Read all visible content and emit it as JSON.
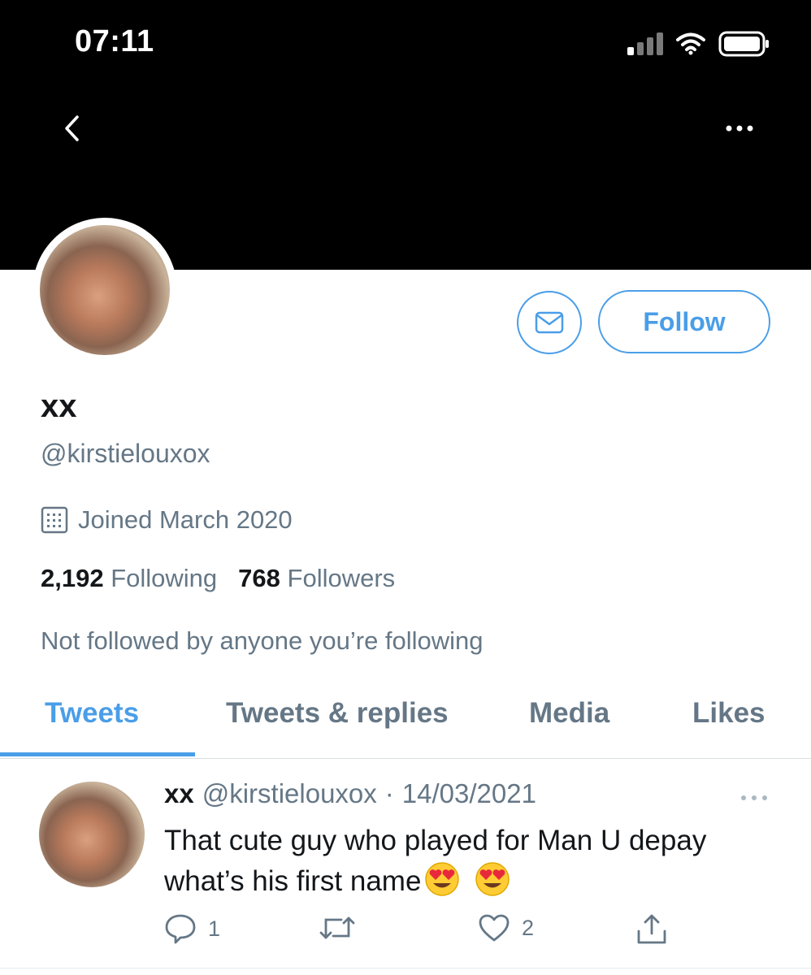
{
  "status_bar": {
    "time": "07:11"
  },
  "profile": {
    "display_name": "xx",
    "handle": "@kirstielouxox",
    "joined": "Joined March 2020",
    "following_count": "2,192",
    "following_label": "Following",
    "followers_count": "768",
    "followers_label": "Followers",
    "not_followed_text": "Not followed by anyone you’re following",
    "follow_label": "Follow"
  },
  "tabs": [
    {
      "label": "Tweets",
      "active": true
    },
    {
      "label": "Tweets & replies",
      "active": false
    },
    {
      "label": "Media",
      "active": false
    },
    {
      "label": "Likes",
      "active": false
    }
  ],
  "tweet": {
    "name": "xx",
    "handle": "@kirstielouxox",
    "separator": "·",
    "date": "14/03/2021",
    "text": "That cute guy who played for Man U depay what’s his first name",
    "emoji": [
      "heart-eyes-emoji",
      "heart-eyes-emoji"
    ],
    "reply_count": "1",
    "like_count": "2"
  },
  "colors": {
    "accent": "#4a9ee8",
    "secondary_text": "#657786",
    "header": "#000000"
  },
  "icons": [
    "back-chevron-icon",
    "more-dots-icon",
    "signal-icon",
    "wifi-icon",
    "battery-icon",
    "mail-icon",
    "calendar-icon",
    "reply-icon",
    "retweet-icon",
    "like-icon",
    "share-icon"
  ]
}
